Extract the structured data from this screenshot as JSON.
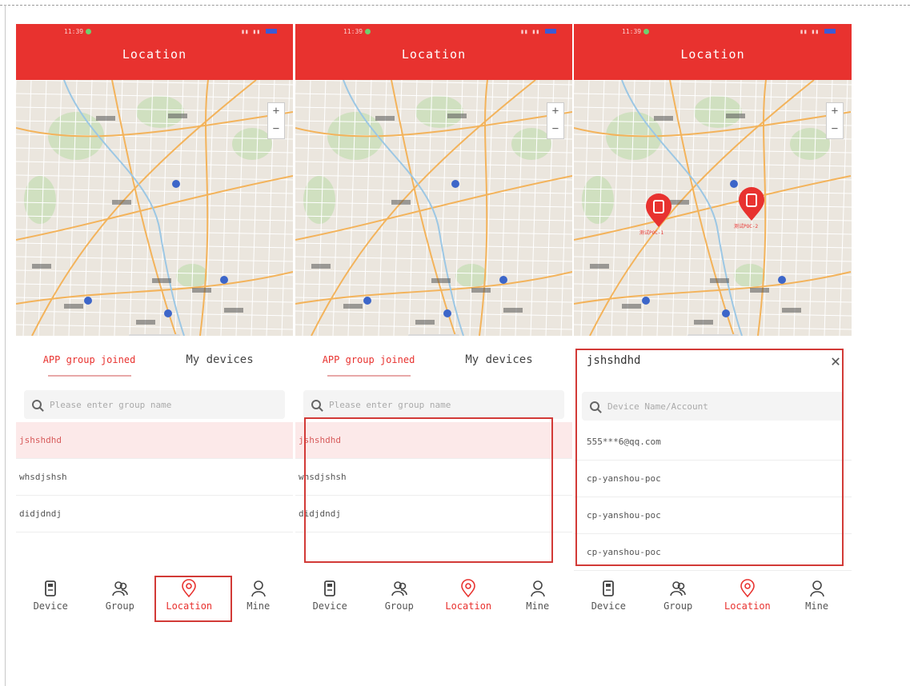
{
  "screens": [
    {
      "status_time": "11:39",
      "title": "Location",
      "tabs": [
        "APP group joined",
        "My devices"
      ],
      "search_placeholder": "Please enter group name",
      "rows": [
        "jshshdhd",
        "whsdjshsh",
        "didjdndj"
      ],
      "nav": [
        "Device",
        "Group",
        "Location",
        "Mine"
      ]
    },
    {
      "status_time": "11:39",
      "title": "Location",
      "tabs": [
        "APP group joined",
        "My devices"
      ],
      "search_placeholder": "Please enter group name",
      "rows": [
        "jshshdhd",
        "whsdjshsh",
        "didjdndj"
      ],
      "nav": [
        "Device",
        "Group",
        "Location",
        "Mine"
      ]
    },
    {
      "status_time": "11:39",
      "title": "Location",
      "group_name": "jshshdhd",
      "search_placeholder": "Device Name/Account",
      "rows": [
        "555***6@qq.com",
        "cp-yanshou-poc",
        "cp-yanshou-poc",
        "cp-yanshou-poc"
      ],
      "map_markers": [
        "测试POC-1",
        "测试POC-2"
      ],
      "nav": [
        "Device",
        "Group",
        "Location",
        "Mine"
      ]
    }
  ],
  "colors": {
    "brand": "#e8322f",
    "selected_row": "#fce9e9",
    "highlight_box": "#d23a37"
  },
  "icons": [
    "device-icon",
    "group-icon",
    "location-pin-icon",
    "mine-person-icon",
    "search-icon",
    "close-icon",
    "zoom-in-icon",
    "zoom-out-icon",
    "map-marker-icon"
  ]
}
